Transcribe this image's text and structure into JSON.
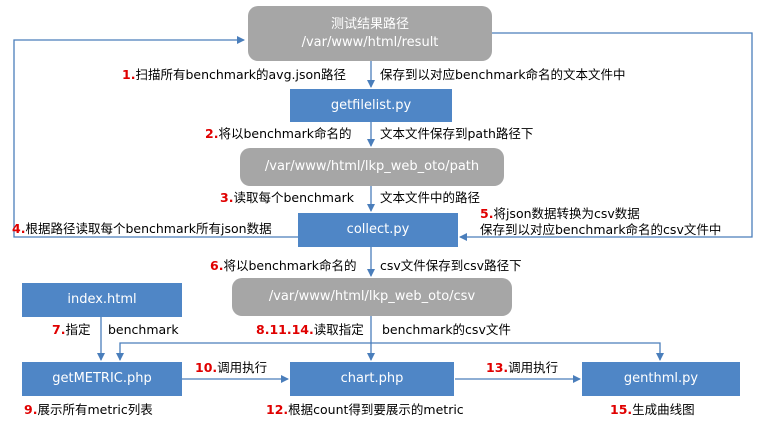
{
  "nodes": {
    "result": {
      "line1": "测试结果路径",
      "line2": "/var/www/html/result"
    },
    "getfilelist": {
      "text": "getfilelist.py"
    },
    "path": {
      "text": "/var/www/html/lkp_web_oto/path"
    },
    "collect": {
      "text": "collect.py"
    },
    "csv": {
      "text": "/var/www/html/lkp_web_oto/csv"
    },
    "index": {
      "text": "index.html"
    },
    "getmetric": {
      "text": "getMETRIC.php"
    },
    "chart": {
      "text": "chart.php"
    },
    "genthml": {
      "text": "genthml.py"
    }
  },
  "labels": {
    "s1": {
      "num": "1.",
      "text": "扫描所有benchmark的avg.json路径"
    },
    "s1b": {
      "text": "保存到以对应benchmark命名的文本文件中"
    },
    "s2": {
      "num": "2.",
      "text": "将以benchmark命名的"
    },
    "s2b": {
      "text": "文本文件保存到path路径下"
    },
    "s3": {
      "num": "3.",
      "text": "读取每个benchmark"
    },
    "s3b": {
      "text": "文本文件中的路径"
    },
    "s4": {
      "num": "4.",
      "text": "根据路径读取每个benchmark所有json数据"
    },
    "s5": {
      "num": "5.",
      "text": "将json数据转换为csv数据"
    },
    "s5b": {
      "text": "保存到以对应benchmark命名的csv文件中"
    },
    "s6": {
      "num": "6.",
      "text": "将以benchmark命名的"
    },
    "s6b": {
      "text": "csv文件保存到csv路径下"
    },
    "s7": {
      "num": "7.",
      "text": "指定"
    },
    "s7b": {
      "text": "benchmark"
    },
    "s8": {
      "num": "8.11.14.",
      "text": "读取指定"
    },
    "s8b": {
      "text": "benchmark的csv文件"
    },
    "s9": {
      "num": "9.",
      "text": "展示所有metric列表"
    },
    "s10": {
      "num": "10.",
      "text": "调用执行"
    },
    "s12": {
      "num": "12.",
      "text": "根据count得到要展示的metric"
    },
    "s13": {
      "num": "13.",
      "text": "调用执行"
    },
    "s15": {
      "num": "15.",
      "text": "生成曲线图"
    }
  },
  "colors": {
    "blue_box": "#4f86c6",
    "gray_box": "#a6a6a6",
    "arrow": "#4a7ebb",
    "step_number": "#e00000"
  }
}
